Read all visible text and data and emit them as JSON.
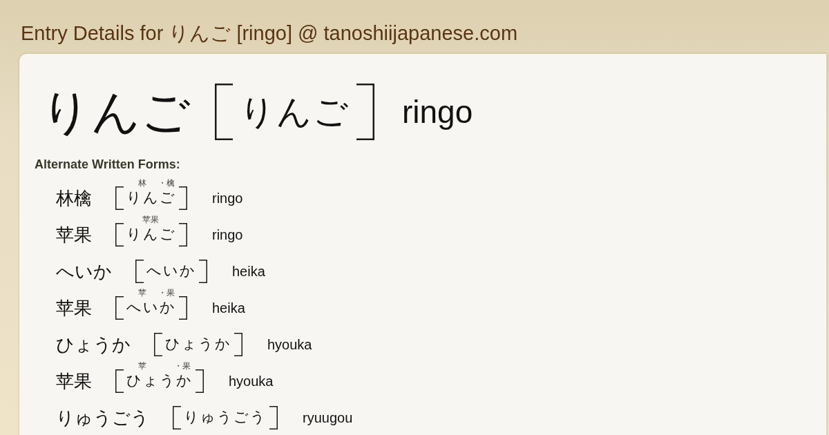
{
  "page": {
    "title": "Entry Details for りんご [ringo] @ tanoshiijapanese.com"
  },
  "entry": {
    "word": "りんご",
    "reading": [
      {
        "kana": "りんご"
      }
    ],
    "romaji": "ringo"
  },
  "alternate_forms": {
    "heading": "Alternate Written Forms:",
    "items": [
      {
        "word": "林檎",
        "reading": [
          {
            "kana": "りん",
            "furigana": "林"
          },
          {
            "kana": "ご",
            "furigana": "・檎"
          }
        ],
        "romaji": "ringo"
      },
      {
        "word": "苹果",
        "reading": [
          {
            "kana": "りんご",
            "furigana": "苹果"
          }
        ],
        "romaji": "ringo"
      },
      {
        "word": "へいか",
        "reading": [
          {
            "kana": "へいか"
          }
        ],
        "romaji": "heika"
      },
      {
        "word": "苹果",
        "reading": [
          {
            "kana": "へい",
            "furigana": "苹"
          },
          {
            "kana": "か",
            "furigana": "・果"
          }
        ],
        "romaji": "heika"
      },
      {
        "word": "ひょうか",
        "reading": [
          {
            "kana": "ひょうか"
          }
        ],
        "romaji": "hyouka"
      },
      {
        "word": "苹果",
        "reading": [
          {
            "kana": "ひょ",
            "furigana": "苹"
          },
          {
            "kana": "う"
          },
          {
            "kana": "か",
            "furigana": "・果"
          }
        ],
        "romaji": "hyouka"
      },
      {
        "word": "りゅうごう",
        "reading": [
          {
            "kana": "りゅうごう"
          }
        ],
        "romaji": "ryuugou"
      }
    ]
  }
}
